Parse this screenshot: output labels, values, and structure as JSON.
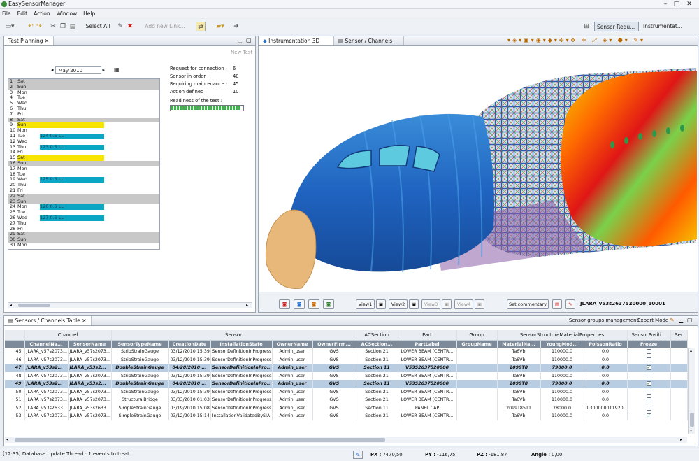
{
  "app": {
    "title": "EasySensorManager",
    "menu": [
      "File",
      "Edit",
      "Action",
      "Window",
      "Help"
    ]
  },
  "toolbar": {
    "select_all": "Select All",
    "add_link": "Add new Link...",
    "perspective_1": "Sensor Requ...",
    "perspective_2": "Instrumentat..."
  },
  "planning": {
    "tab": "Test Planning",
    "new_test": "New Test",
    "month": "May 2010",
    "stats": [
      {
        "label": "Request for connection :",
        "value": "6"
      },
      {
        "label": "Sensor in order :",
        "value": "40"
      },
      {
        "label": "Requiring maintenance :",
        "value": "45"
      },
      {
        "label": "Action defined :",
        "value": "10"
      }
    ],
    "readiness_label": "Readiness of the test :",
    "readiness": 0.97,
    "days": [
      {
        "n": "1",
        "d": "Sat",
        "t": "we",
        "e": ""
      },
      {
        "n": "2",
        "d": "Sun",
        "t": "we",
        "e": ""
      },
      {
        "n": "3",
        "d": "Mon",
        "t": "",
        "e": ""
      },
      {
        "n": "4",
        "d": "Tue",
        "t": "",
        "e": ""
      },
      {
        "n": "5",
        "d": "Wed",
        "t": "",
        "e": ""
      },
      {
        "n": "6",
        "d": "Thu",
        "t": "",
        "e": ""
      },
      {
        "n": "7",
        "d": "Fri",
        "t": "",
        "e": ""
      },
      {
        "n": "8",
        "d": "Sat",
        "t": "we",
        "e": ""
      },
      {
        "n": "9",
        "d": "Sun",
        "t": "yl",
        "e": ""
      },
      {
        "n": "10",
        "d": "Mon",
        "t": "",
        "e": ""
      },
      {
        "n": "11",
        "d": "Tue",
        "t": "bl",
        "e": "124 0.5 LL"
      },
      {
        "n": "12",
        "d": "Wed",
        "t": "",
        "e": ""
      },
      {
        "n": "13",
        "d": "Thu",
        "t": "bl",
        "e": "123 0.5 LL"
      },
      {
        "n": "14",
        "d": "Fri",
        "t": "",
        "e": ""
      },
      {
        "n": "15",
        "d": "Sat",
        "t": "yl",
        "e": ""
      },
      {
        "n": "16",
        "d": "Sun",
        "t": "we",
        "e": ""
      },
      {
        "n": "17",
        "d": "Mon",
        "t": "",
        "e": ""
      },
      {
        "n": "18",
        "d": "Tue",
        "t": "",
        "e": ""
      },
      {
        "n": "19",
        "d": "Wed",
        "t": "bl",
        "e": "125 0.5 LL"
      },
      {
        "n": "20",
        "d": "Thu",
        "t": "",
        "e": ""
      },
      {
        "n": "21",
        "d": "Fri",
        "t": "",
        "e": ""
      },
      {
        "n": "22",
        "d": "Sat",
        "t": "we",
        "e": ""
      },
      {
        "n": "23",
        "d": "Sun",
        "t": "we",
        "e": ""
      },
      {
        "n": "24",
        "d": "Mon",
        "t": "bl",
        "e": "126 0.5 LL"
      },
      {
        "n": "25",
        "d": "Tue",
        "t": "",
        "e": ""
      },
      {
        "n": "26",
        "d": "Wed",
        "t": "bl",
        "e": "127 0.5 LL"
      },
      {
        "n": "27",
        "d": "Thu",
        "t": "",
        "e": ""
      },
      {
        "n": "28",
        "d": "Fri",
        "t": "",
        "e": ""
      },
      {
        "n": "29",
        "d": "Sat",
        "t": "we",
        "e": ""
      },
      {
        "n": "30",
        "d": "Sun",
        "t": "we",
        "e": ""
      },
      {
        "n": "31",
        "d": "Mon",
        "t": "",
        "e": ""
      }
    ]
  },
  "view3d": {
    "tab1": "Instrumentation 3D View",
    "tab2": "Sensor / Channels Details",
    "view_buttons": [
      "View1",
      "View2",
      "View3",
      "View4"
    ],
    "set_commentary": "Set commentary",
    "model_label": "JLARA_v53s2637520000_10001"
  },
  "table": {
    "tab": "Sensors / Channels Table",
    "groups_mgmt": "Sensor groups management",
    "expert_mode": "Expert Mode",
    "groups": [
      "Channel",
      "Sensor",
      "ACSection",
      "Part",
      "Group",
      "SensorStructureMaterialProperties",
      "SensorPositi...",
      "Ser"
    ],
    "columns": [
      "ChannelNa...",
      "SensorName",
      "SensorTypeName",
      "CreationDate",
      "InstallationState",
      "OwnerName",
      "OwnerFirm...",
      "ACSection...",
      "PartLabel",
      "GroupName",
      "MaterialNa...",
      "YoungMod...",
      "PoissonRatio",
      "Freeze"
    ],
    "rows": [
      {
        "id": "45",
        "c": [
          "JLARA_v57s2073...",
          "JLARA_v57s2073...",
          "StripStrainGauge",
          "03/12/2010 15:39...",
          "SensorDefinitionInProgress...",
          "Admin_user",
          "GVS",
          "Section 21",
          "LOWER BEAM (CENTR...",
          "",
          "Ta6Vb",
          "110000.0",
          "0.0"
        ],
        "chk": false,
        "sel": false
      },
      {
        "id": "46",
        "c": [
          "JLARA_v57s2073...",
          "JLARA_v57s2073...",
          "StripStrainGauge",
          "03/12/2010 15:39...",
          "SensorDefinitionInProgress...",
          "Admin_user",
          "GVS",
          "Section 21",
          "LOWER BEAM (CENTR...",
          "",
          "Ta6Vb",
          "110000.0",
          "0.0"
        ],
        "chk": false,
        "sel": false
      },
      {
        "id": "47",
        "c": [
          "JLARA_v53s2...",
          "JLARA_v53s2...",
          "DoubleStrainGauge",
          "04/28/2010 ...",
          "SensorDefinitionInPro...",
          "Admin_user",
          "GVS",
          "Section 11",
          "V53S2637520000",
          "",
          "2099T8",
          "79000.0",
          "0.0"
        ],
        "chk": true,
        "sel": true
      },
      {
        "id": "48",
        "c": [
          "JLARA_v57s2073...",
          "JLARA_v57s2073...",
          "StripStrainGauge",
          "03/12/2010 15:39...",
          "SensorDefinitionInProgress...",
          "Admin_user",
          "GVS",
          "Section 21",
          "LOWER BEAM (CENTR...",
          "",
          "Ta6Vb",
          "110000.0",
          "0.0"
        ],
        "chk": false,
        "sel": false
      },
      {
        "id": "49",
        "c": [
          "JLARA_v53s2...",
          "JLARA_v53s2...",
          "DoubleStrainGauge",
          "04/28/2010 ...",
          "SensorDefinitionInPro...",
          "Admin_user",
          "GVS",
          "Section 11",
          "V53S2637520000",
          "",
          "2099T8",
          "79000.0",
          "0.0"
        ],
        "chk": true,
        "sel": true
      },
      {
        "id": "50",
        "c": [
          "JLARA_v57s2073...",
          "JLARA_v57s2073...",
          "StripStrainGauge",
          "03/12/2010 15:39...",
          "SensorDefinitionInProgress...",
          "Admin_user",
          "GVS",
          "Section 21",
          "LOWER BEAM (CENTR...",
          "",
          "Ta6Vb",
          "110000.0",
          "0.0"
        ],
        "chk": false,
        "sel": false
      },
      {
        "id": "51",
        "c": [
          "JLARA_v57s2073...",
          "JLARA_v57s2073...",
          "StructuralBridge",
          "03/03/2010 01:03...",
          "SensorDefinitionInProgress...",
          "Admin_user",
          "GVS",
          "Section 21",
          "LOWER BEAM (CENTR...",
          "",
          "Ta6Vb",
          "110000.0",
          "0.0"
        ],
        "chk": false,
        "sel": false
      },
      {
        "id": "52",
        "c": [
          "JLARA_v53s2633...",
          "JLARA_v53s2633...",
          "SimpleStrainGauge",
          "03/19/2010 15:08...",
          "SensorDefinitionInProgress...",
          "Admin_user",
          "GVS",
          "Section 11",
          "PANEL CAP",
          "",
          "2099T8511",
          "78000.0",
          "0.300000011920..."
        ],
        "chk": false,
        "sel": false
      },
      {
        "id": "53",
        "c": [
          "JLARA_v57s2073...",
          "JLARA_v57s2073...",
          "SimpleStrainGauge",
          "03/12/2010 15:14...",
          "InstallationValidatedBySIA",
          "Admin_user",
          "GVS",
          "Section 21",
          "LOWER BEAM (CENTR...",
          "",
          "Ta6Vb",
          "110000.0",
          "0.0"
        ],
        "chk": true,
        "sel": false
      }
    ]
  },
  "status": {
    "message": "[12:35] Database Update Thread : 1 events to treat.",
    "px_label": "PX :",
    "px": "7470,50",
    "py_label": "PY :",
    "py": "-116,75",
    "pz_label": "PZ :",
    "pz": "-181,87",
    "angle_label": "Angle :",
    "angle": "0,00"
  },
  "colors": {
    "weekend": "#c8c8c8",
    "highlight": "#f7e500",
    "event": "#0aa6c4",
    "fuselage": "#2a6fc9",
    "nose": "#e8b87a"
  }
}
